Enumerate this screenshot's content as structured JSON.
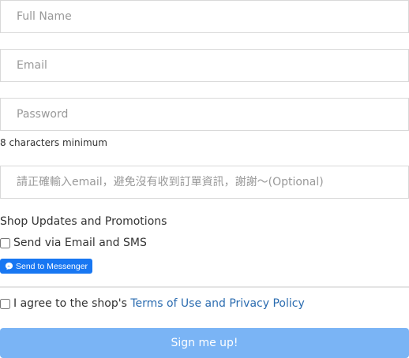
{
  "form": {
    "full_name_placeholder": "Full Name",
    "email_placeholder": "Email",
    "password_placeholder": "Password",
    "password_hint": "8 characters minimum",
    "optional_placeholder": "請正確輸入email，避免沒有收到訂單資訊，謝謝～(Optional)"
  },
  "updates": {
    "title": "Shop Updates and Promotions",
    "sms_label": "Send via Email and SMS",
    "messenger_label": "Send to Messenger",
    "messenger_icon": "messenger-icon",
    "messenger_color": "#1877f2"
  },
  "agreement": {
    "prefix": "I agree to the shop's ",
    "link": "Terms of Use and Privacy Policy"
  },
  "submit": {
    "label": "Sign me up!",
    "color": "#7ab4f5"
  }
}
